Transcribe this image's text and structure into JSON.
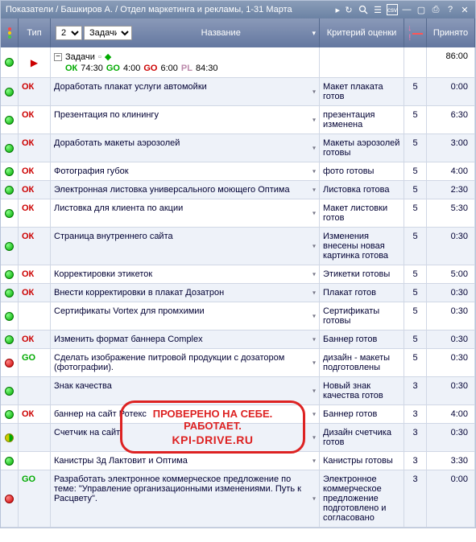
{
  "title": "Показатели / Башкиров А. / Отдел маркетинга и рекламы, 1-31 Марта",
  "header": {
    "type": "Тип",
    "select_val": "2",
    "select2_val": "Задачи",
    "name": "Название",
    "crit": "Критерий оценки",
    "weight": "↓ !",
    "accepted": "Принято"
  },
  "summary": {
    "label": "Задачи",
    "ok": "ОК",
    "ok_v": "74:30",
    "go": "GO",
    "go_v": "4:00",
    "go2": "GO",
    "go2_v": "6:00",
    "pl": "PL",
    "pl_v": "84:30",
    "accepted": "86:00"
  },
  "rows": [
    {
      "s": "g",
      "t": "ОК",
      "tc": "r",
      "n": "Доработать плакат услуги автомойки",
      "c": "Макет плаката готов",
      "w": "5",
      "a": "0:00"
    },
    {
      "s": "g",
      "t": "ОК",
      "tc": "r",
      "n": "Презентация по клинингу",
      "c": "презентация изменена",
      "w": "5",
      "a": "6:30"
    },
    {
      "s": "g",
      "t": "ОК",
      "tc": "r",
      "n": "Доработать макеты аэрозолей",
      "c": "Макеты аэрозолей готовы",
      "w": "5",
      "a": "3:00"
    },
    {
      "s": "g",
      "t": "ОК",
      "tc": "r",
      "n": "Фотография губок",
      "c": "фото готовы",
      "w": "5",
      "a": "4:00"
    },
    {
      "s": "g",
      "t": "ОК",
      "tc": "r",
      "n": "Электронная листовка универсального моющего Оптима",
      "c": "Листовка готова",
      "w": "5",
      "a": "2:30"
    },
    {
      "s": "g",
      "t": "ОК",
      "tc": "r",
      "n": "Листовка для клиента по акции",
      "c": "Макет листовки готов",
      "w": "5",
      "a": "5:30"
    },
    {
      "s": "g",
      "t": "ОК",
      "tc": "r",
      "n": "Страница внутреннего сайта",
      "c": "Изменения внесены новая картинка готова",
      "w": "5",
      "a": "0:30"
    },
    {
      "s": "g",
      "t": "ОК",
      "tc": "r",
      "n": "Корректировки этикеток",
      "c": "Этикетки готовы",
      "w": "5",
      "a": "5:00"
    },
    {
      "s": "g",
      "t": "ОК",
      "tc": "r",
      "n": "Внести корректировки в плакат Дозатрон",
      "c": "Плакат готов",
      "w": "5",
      "a": "0:30"
    },
    {
      "s": "g",
      "t": "",
      "tc": "r",
      "n": "Сертификаты Vortex для промхимии",
      "c": "Сертификаты готовы",
      "w": "5",
      "a": "0:30"
    },
    {
      "s": "g",
      "t": "ОК",
      "tc": "r",
      "n": "Изменить формат баннера Complex",
      "c": "Баннер готов",
      "w": "5",
      "a": "0:30"
    },
    {
      "s": "r",
      "t": "GO",
      "tc": "g",
      "n": "Сделать изображение питровой продукции с дозатором (фотографии).",
      "c": "дизайн - макеты подготовлены",
      "w": "5",
      "a": "0:30"
    },
    {
      "s": "g",
      "t": "",
      "tc": "r",
      "n": "Знак качества",
      "c": "Новый знак качества готов",
      "w": "3",
      "a": "0:30"
    },
    {
      "s": "g",
      "t": "ОК",
      "tc": "r",
      "n": "баннер на сайт Ротекс",
      "c": "Баннер готов",
      "w": "3",
      "a": "4:00"
    },
    {
      "s": "m",
      "t": "",
      "tc": "r",
      "n": "Счетчик на сайт",
      "c": "Дизайн счетчика готов",
      "w": "3",
      "a": "0:30"
    },
    {
      "s": "g",
      "t": "",
      "tc": "r",
      "n": "Канистры 3д Лактовит и Оптима",
      "c": "Канистры готовы",
      "w": "3",
      "a": "3:30"
    },
    {
      "s": "r",
      "t": "GO",
      "tc": "g",
      "n": "Разработать электронное коммерческое предложение по теме: \"Управление организационными изменениями. Путь к Расцвету\".",
      "c": "Электронное коммерческое предложение подготовлено и согласовано",
      "w": "3",
      "a": "0:00"
    }
  ],
  "stamp": {
    "line1": "ПРОВЕРЕНО НА СЕБЕ.",
    "line2": "РАБОТАЕТ.",
    "line3": "KPI-DRIVE.RU"
  }
}
